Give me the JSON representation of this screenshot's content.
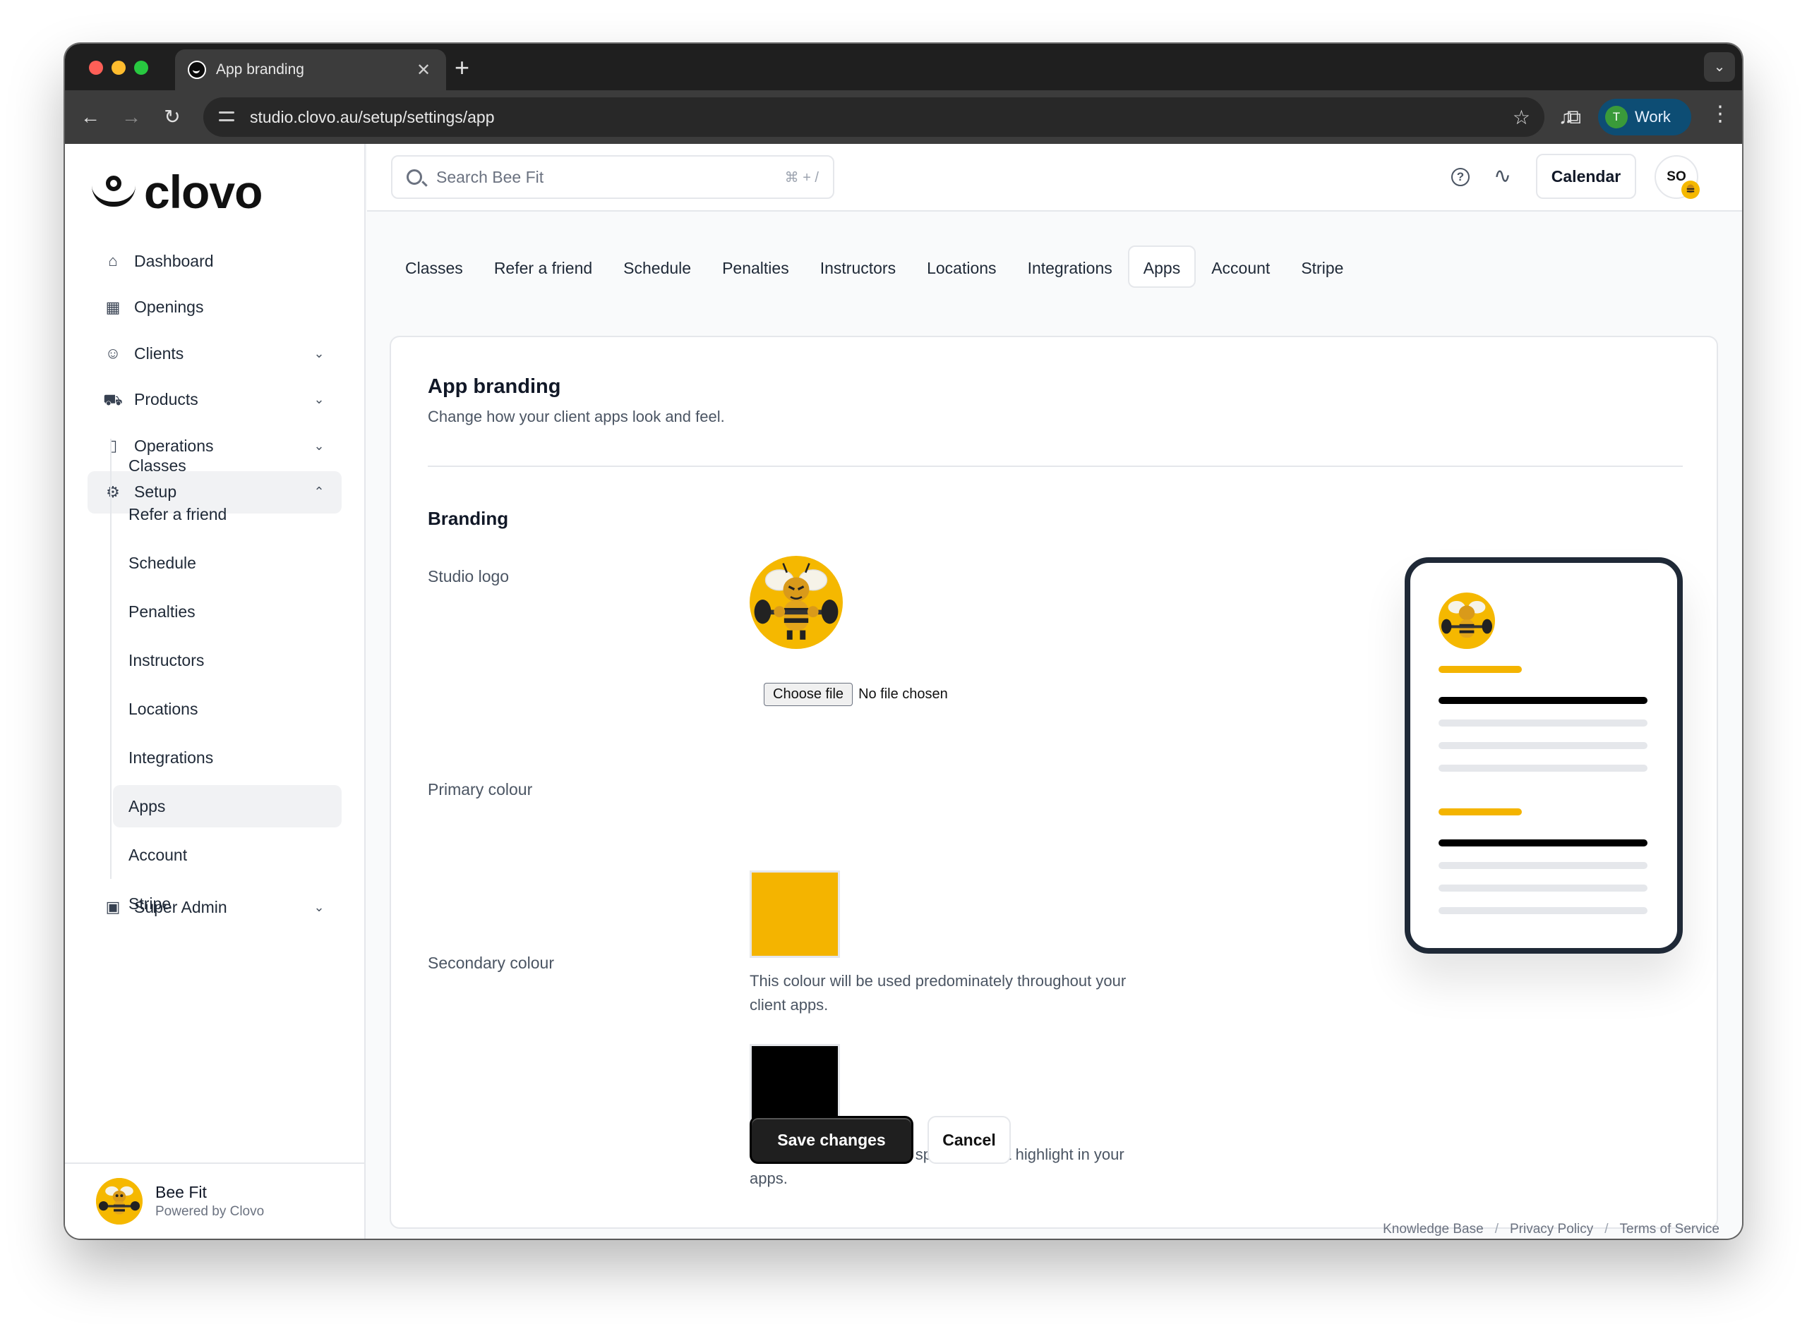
{
  "browser": {
    "tab_title": "App branding",
    "url": "studio.clovo.au/setup/settings/app",
    "profile_initial": "T",
    "profile_label": "Work"
  },
  "brand": {
    "logo_text": "clovo",
    "primary_color": "#f4b400",
    "secondary_color": "#000000"
  },
  "sidebar": {
    "items": [
      {
        "label": "Dashboard",
        "icon": "home-icon"
      },
      {
        "label": "Openings",
        "icon": "calendar-icon"
      },
      {
        "label": "Clients",
        "icon": "users-icon",
        "expandable": true
      },
      {
        "label": "Products",
        "icon": "cart-icon",
        "expandable": true
      },
      {
        "label": "Operations",
        "icon": "document-icon",
        "expandable": true
      },
      {
        "label": "Setup",
        "icon": "gear-icon",
        "expandable": true,
        "expanded": true
      }
    ],
    "setup_children": [
      "Classes",
      "Refer a friend",
      "Schedule",
      "Penalties",
      "Instructors",
      "Locations",
      "Integrations",
      "Apps",
      "Account",
      "Stripe"
    ],
    "setup_active": "Apps",
    "super_admin": "Super Admin",
    "footer": {
      "studio_name": "Bee Fit",
      "powered_by": "Powered by Clovo"
    }
  },
  "topbar": {
    "search_placeholder": "Search Bee Fit",
    "search_shortcut": "⌘ + /",
    "calendar_button": "Calendar",
    "user_initials": "SO"
  },
  "settings_tabs": {
    "items": [
      "Classes",
      "Refer a friend",
      "Schedule",
      "Penalties",
      "Instructors",
      "Locations",
      "Integrations",
      "Apps",
      "Account",
      "Stripe"
    ],
    "active": "Apps"
  },
  "page": {
    "title": "App branding",
    "subtitle": "Change how your client apps look and feel.",
    "section_title": "Branding",
    "studio_logo_label": "Studio logo",
    "file_button": "Choose file",
    "file_status": "No file chosen",
    "primary_label": "Primary colour",
    "primary_help": "This colour will be used predominately throughout your client apps.",
    "secondary_label": "Secondary colour",
    "secondary_help": "This colour will be used sparingly as a highlight in your apps.",
    "save_button": "Save changes",
    "cancel_button": "Cancel"
  },
  "footer_links": [
    "Knowledge Base",
    "Privacy Policy",
    "Terms of Service"
  ]
}
